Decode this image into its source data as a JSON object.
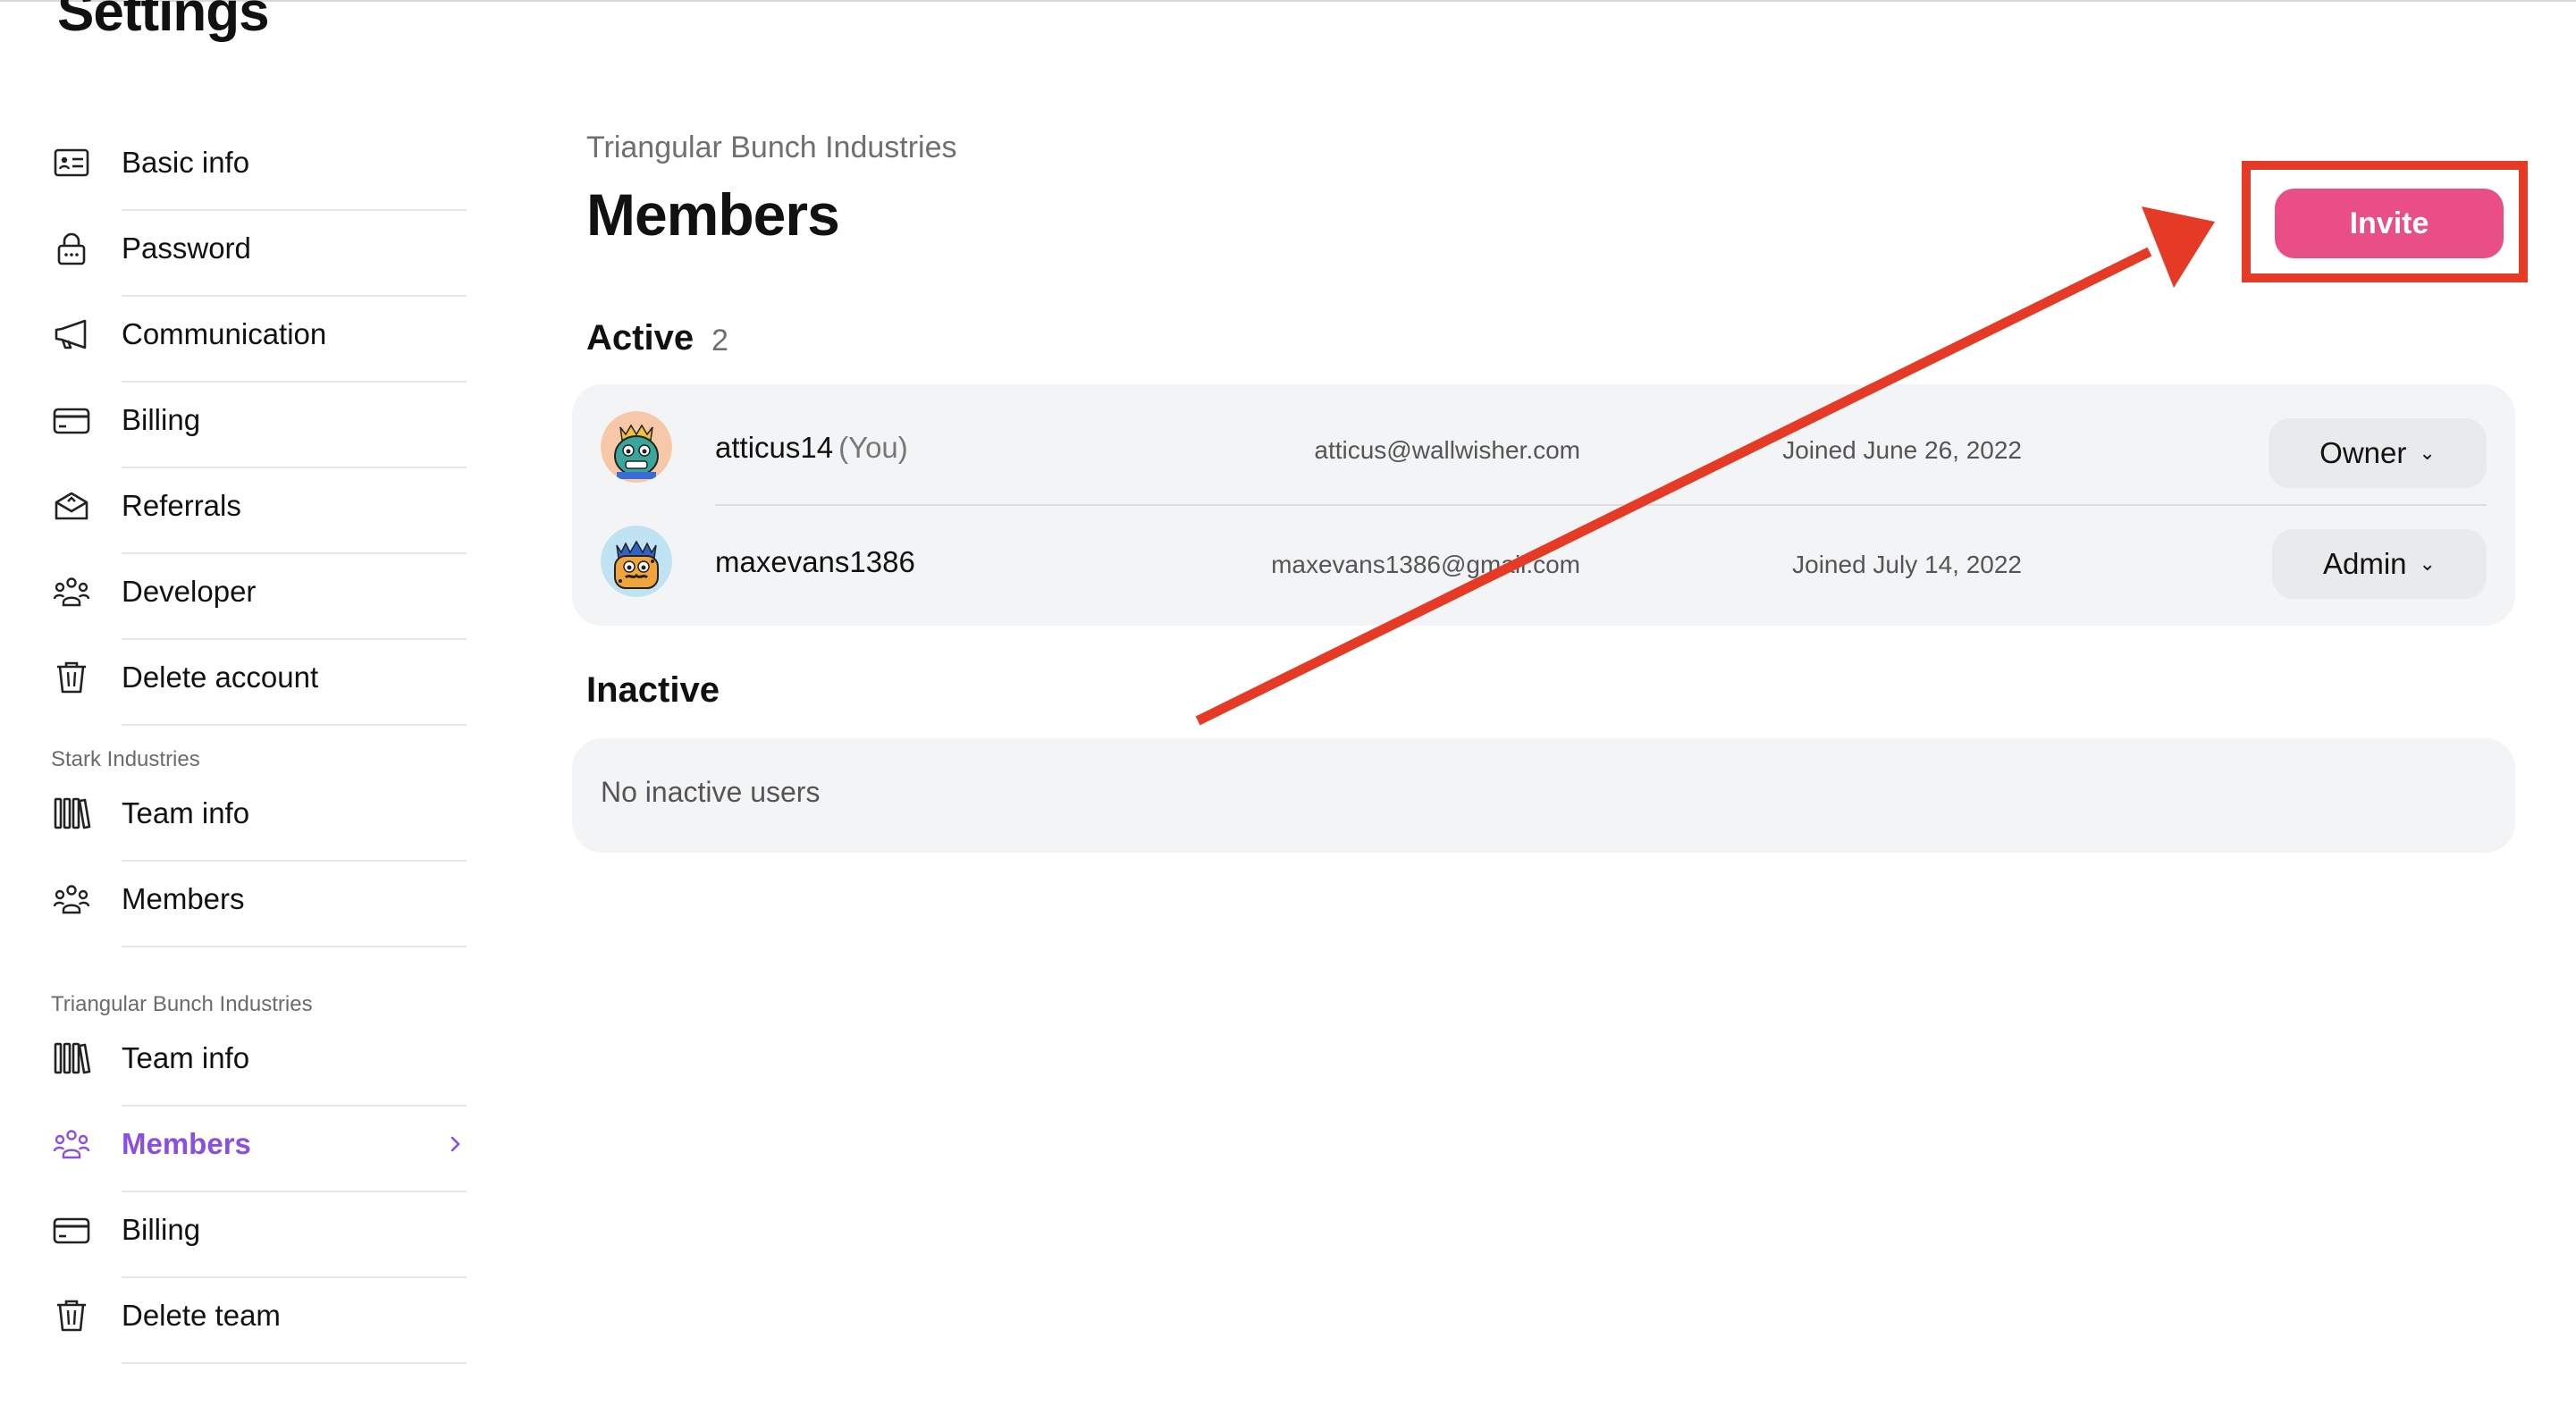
{
  "page": {
    "title": "Settings"
  },
  "sidebar": {
    "account_items": [
      {
        "label": "Basic info",
        "icon": "id-card-icon"
      },
      {
        "label": "Password",
        "icon": "lock-icon"
      },
      {
        "label": "Communication",
        "icon": "megaphone-icon"
      },
      {
        "label": "Billing",
        "icon": "credit-card-icon"
      },
      {
        "label": "Referrals",
        "icon": "gift-box-icon"
      },
      {
        "label": "Developer",
        "icon": "people-icon"
      },
      {
        "label": "Delete account",
        "icon": "trash-icon"
      }
    ],
    "groups": [
      {
        "title": "Stark Industries",
        "items": [
          {
            "label": "Team info",
            "icon": "books-icon"
          },
          {
            "label": "Members",
            "icon": "people-icon"
          }
        ]
      },
      {
        "title": "Triangular Bunch Industries",
        "items": [
          {
            "label": "Team info",
            "icon": "books-icon"
          },
          {
            "label": "Members",
            "icon": "people-icon",
            "active": true
          },
          {
            "label": "Billing",
            "icon": "credit-card-icon"
          },
          {
            "label": "Delete team",
            "icon": "trash-icon"
          }
        ]
      }
    ],
    "active_color": "#8a4fe0"
  },
  "main": {
    "org_name": "Triangular Bunch Industries",
    "title": "Members",
    "invite_label": "Invite",
    "active": {
      "heading": "Active",
      "count": "2",
      "members": [
        {
          "username": "atticus14",
          "you_tag": "(You)",
          "email": "atticus@wallwisher.com",
          "joined": "Joined June 26, 2022",
          "role": "Owner",
          "avatar": "monster-avatar-teal"
        },
        {
          "username": "maxevans1386",
          "you_tag": "",
          "email": "maxevans1386@gmail.com",
          "joined": "Joined July 14, 2022",
          "role": "Admin",
          "avatar": "monster-avatar-orange"
        }
      ]
    },
    "inactive": {
      "heading": "Inactive",
      "empty_text": "No inactive users"
    }
  },
  "colors": {
    "invite_button": "#e94e84",
    "annotation_red": "#e53a25",
    "card_background": "#f3f4f5"
  }
}
